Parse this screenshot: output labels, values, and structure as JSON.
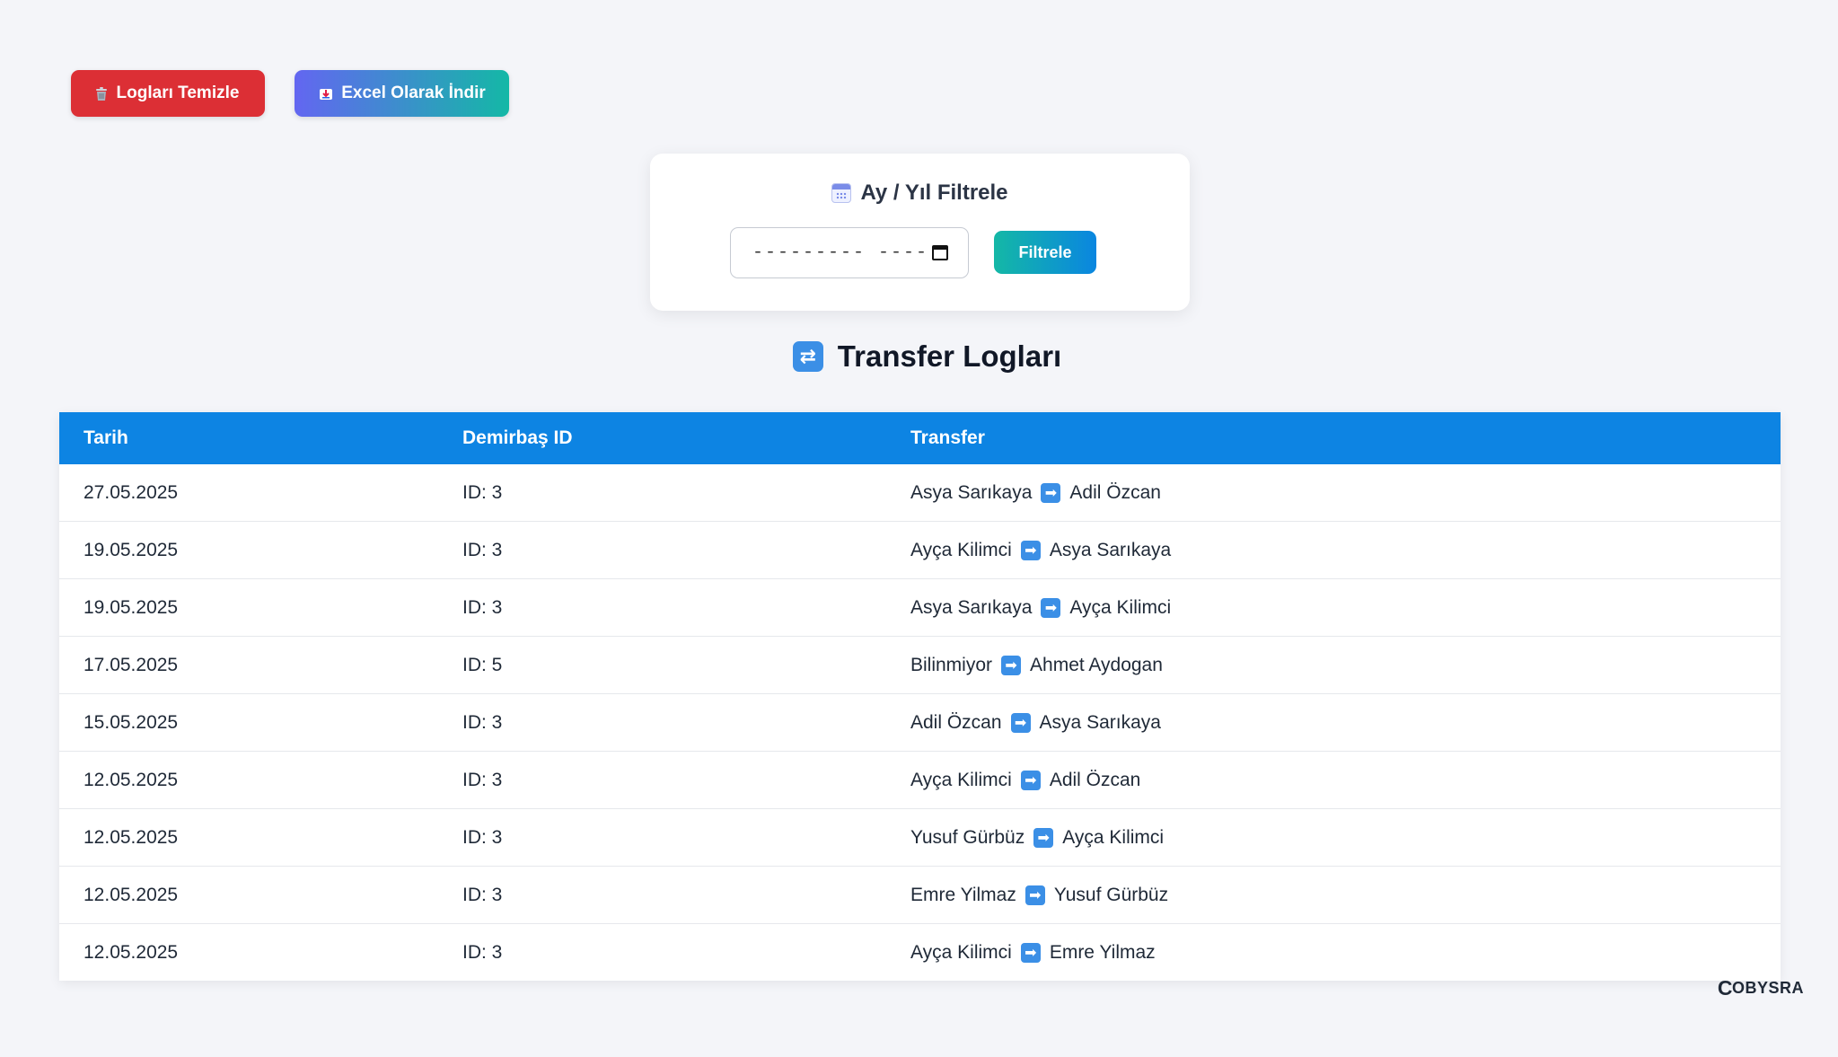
{
  "actions": {
    "clear_label": "Logları Temizle",
    "clear_icon": "wastebasket-icon",
    "excel_label": "Excel Olarak İndir",
    "excel_icon": "download-icon"
  },
  "filter": {
    "title": "Ay / Yıl Filtrele",
    "title_icon": "calendar-icon",
    "input_placeholder": "--------- ----",
    "button_label": "Filtrele"
  },
  "section": {
    "title": "Transfer Logları",
    "icon": "repeat-icon"
  },
  "table": {
    "headers": [
      "Tarih",
      "Demirbaş ID",
      "Transfer"
    ],
    "arrow_icon": "right-arrow-icon",
    "rows": [
      {
        "date": "27.05.2025",
        "id": "ID: 3",
        "from": "Asya Sarıkaya",
        "to": "Adil Özcan"
      },
      {
        "date": "19.05.2025",
        "id": "ID: 3",
        "from": "Ayça Kilimci",
        "to": "Asya Sarıkaya"
      },
      {
        "date": "19.05.2025",
        "id": "ID: 3",
        "from": "Asya Sarıkaya",
        "to": "Ayça Kilimci"
      },
      {
        "date": "17.05.2025",
        "id": "ID: 5",
        "from": "Bilinmiyor",
        "to": "Ahmet Aydogan"
      },
      {
        "date": "15.05.2025",
        "id": "ID: 3",
        "from": "Adil Özcan",
        "to": "Asya Sarıkaya"
      },
      {
        "date": "12.05.2025",
        "id": "ID: 3",
        "from": "Ayça Kilimci",
        "to": "Adil Özcan"
      },
      {
        "date": "12.05.2025",
        "id": "ID: 3",
        "from": "Yusuf Gürbüz",
        "to": "Ayça Kilimci"
      },
      {
        "date": "12.05.2025",
        "id": "ID: 3",
        "from": "Emre Yilmaz",
        "to": "Yusuf Gürbüz"
      },
      {
        "date": "12.05.2025",
        "id": "ID: 3",
        "from": "Ayça Kilimci",
        "to": "Emre Yilmaz"
      }
    ]
  },
  "brand": {
    "logo_letter": "C",
    "name": "OBYSRA"
  },
  "colors": {
    "page_bg": "#f4f5f9",
    "clear_button": "#dc2f35",
    "table_header": "#0d84e3",
    "arrow_badge": "#3b8fe6"
  }
}
